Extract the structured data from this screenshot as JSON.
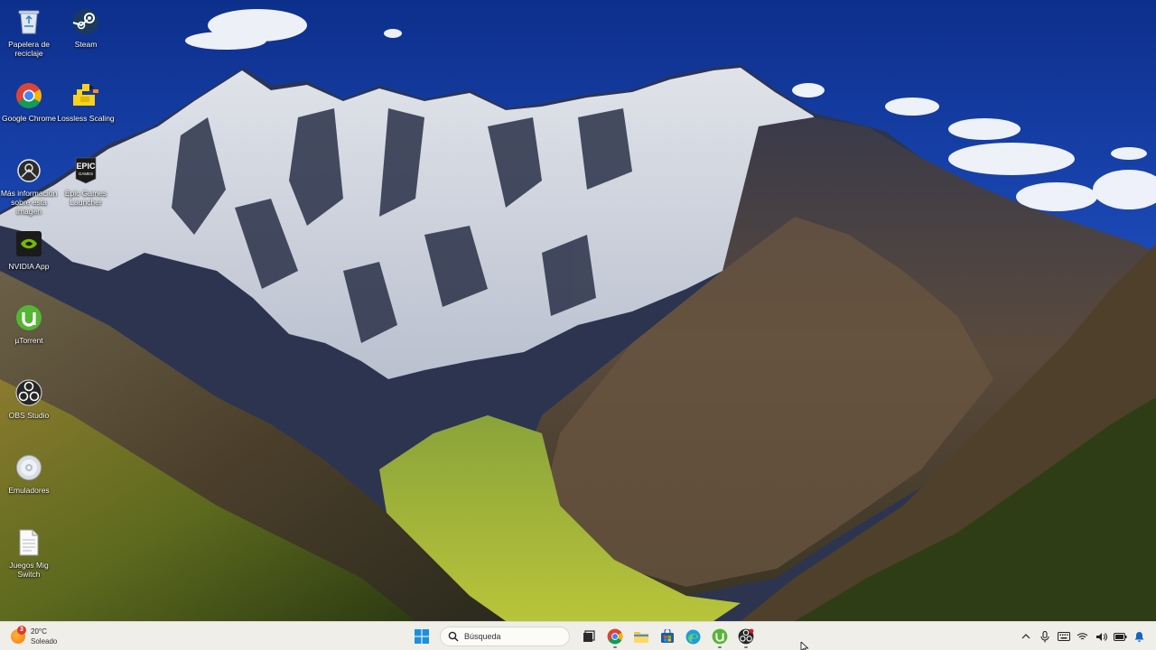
{
  "desktop": {
    "icons": [
      {
        "label": "Papelera de reciclaje",
        "icon": "recycle-bin-icon"
      },
      {
        "label": "Steam",
        "icon": "steam-icon"
      },
      {
        "label": "Google Chrome",
        "icon": "chrome-icon"
      },
      {
        "label": "Lossless Scaling",
        "icon": "lossless-scaling-icon"
      },
      {
        "label": "Más información sobre esta imagen",
        "icon": "spotlight-info-icon"
      },
      {
        "label": "Epic Games Launcher",
        "icon": "epic-games-icon"
      },
      {
        "label": "NVIDIA App",
        "icon": "nvidia-icon"
      },
      {
        "label": "µTorrent",
        "icon": "utorrent-icon"
      },
      {
        "label": "OBS Studio",
        "icon": "obs-icon"
      },
      {
        "label": "Emuladores",
        "icon": "disc-icon"
      },
      {
        "label": "Juegos Mig Switch",
        "icon": "document-icon"
      }
    ]
  },
  "taskbar": {
    "weather": {
      "temperature": "20°C",
      "condition": "Soleado",
      "badge_count": "3",
      "icon": "sun-icon"
    },
    "start_icon": "windows-start-icon",
    "search": {
      "placeholder": "Búsqueda",
      "value": ""
    },
    "pinned": [
      {
        "icon": "task-view-icon"
      },
      {
        "icon": "chrome-icon",
        "running": true
      },
      {
        "icon": "file-explorer-icon"
      },
      {
        "icon": "microsoft-store-icon"
      },
      {
        "icon": "edge-icon"
      },
      {
        "icon": "utorrent-icon",
        "running": true
      },
      {
        "icon": "obs-icon",
        "running": true
      }
    ],
    "tray": [
      "chevron-up-icon",
      "microphone-icon",
      "keyboard-icon",
      "wifi-icon",
      "speaker-icon",
      "battery-icon",
      "notification-bell-icon"
    ]
  },
  "colors": {
    "sky": "#1c3fa0",
    "taskbar": "#efeee8",
    "accent": "#0067c0"
  }
}
